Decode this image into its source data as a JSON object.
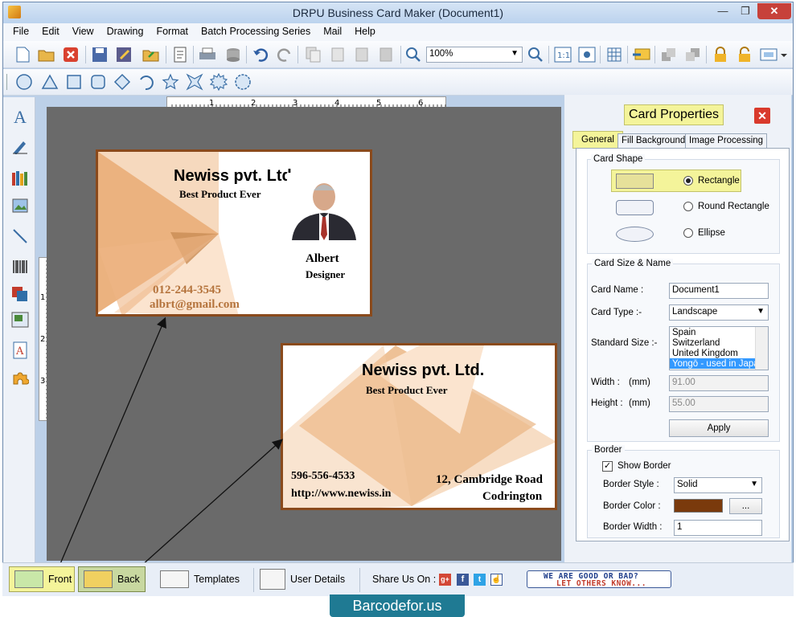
{
  "window": {
    "title": "DRPU Business Card Maker (Document1)"
  },
  "menu": [
    "File",
    "Edit",
    "View",
    "Drawing",
    "Format",
    "Batch Processing Series",
    "Mail",
    "Help"
  ],
  "toolbar": {
    "zoom": "100%"
  },
  "ruler": {
    "ticks": [
      "1",
      "2",
      "3",
      "4",
      "5",
      "6"
    ],
    "vticks": [
      "1",
      "2",
      "3"
    ]
  },
  "front_card": {
    "company": "Newiss pvt. Ltd.",
    "tagline": "Best Product Ever",
    "name": "Albert",
    "title": "Designer",
    "phone": "012-244-3545",
    "email": "albrt@gmail.com"
  },
  "back_card": {
    "company": "Newiss pvt. Ltd.",
    "tagline": "Best Product Ever",
    "phone": "596-556-4533",
    "web": "http://www.newiss.in",
    "address1": "12, Cambridge Road",
    "address2": "Codrington"
  },
  "panel": {
    "title": "Card Properties",
    "tabs": [
      "General",
      "Fill Background",
      "Image Processing"
    ],
    "shape_group": "Card Shape",
    "shapes": [
      "Rectangle",
      "Round Rectangle",
      "Ellipse"
    ],
    "size_group": "Card Size & Name",
    "card_name_label": "Card Name :",
    "card_name": "Document1",
    "card_type_label": "Card Type :-",
    "card_type": "Landscape",
    "standard_size_label": "Standard Size :-",
    "standard_sizes": [
      "Spain",
      "Switzerland",
      "United Kingdom",
      "Yongō - used in Japan"
    ],
    "width_label": "Width :",
    "width_unit": "(mm)",
    "width": "91.00",
    "height_label": "Height :",
    "height_unit": "(mm)",
    "height": "55.00",
    "apply": "Apply",
    "border_group": "Border",
    "show_border": "Show Border",
    "border_style_label": "Border Style :",
    "border_style": "Solid",
    "border_color_label": "Border Color :",
    "border_color": "#7a3a0c",
    "border_color_btn": "...",
    "border_width_label": "Border Width :",
    "border_width": "1"
  },
  "bottom": {
    "front": "Front",
    "back": "Back",
    "templates": "Templates",
    "user_details": "User Details",
    "share": "Share Us On :",
    "feedback_line1": "WE ARE GOOD OR BAD?",
    "feedback_line2": "LET OTHERS KNOW..."
  },
  "footer": "Barcodefor.us"
}
